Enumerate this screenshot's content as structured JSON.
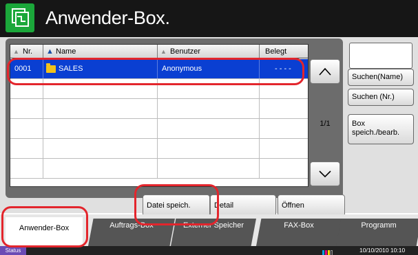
{
  "header": {
    "title": "Anwender-Box.",
    "icon": "document-box-icon"
  },
  "table": {
    "columns": [
      {
        "label": "Nr."
      },
      {
        "label": "Name"
      },
      {
        "label": "Benutzer"
      },
      {
        "label": "Belegt"
      }
    ],
    "rows": [
      {
        "nr": "0001",
        "name": "SALES",
        "user": "Anonymous",
        "used": "- - - -",
        "selected": true
      }
    ]
  },
  "pager": {
    "indicator": "1/1"
  },
  "side": {
    "search_name": "Suchen(Name)",
    "search_nr": "Suchen (Nr.)",
    "box_edit_line1": "Box",
    "box_edit_line2": "speich./bearb."
  },
  "actions": {
    "save_file": "Datei speich.",
    "detail": "Detail",
    "open": "Öffnen"
  },
  "tabs": [
    {
      "label": "Anwender-Box"
    },
    {
      "label": "Auftrags-Box"
    },
    {
      "label": "Externer Speicher"
    },
    {
      "label": "FAX-Box"
    },
    {
      "label": "Programm"
    }
  ],
  "status": {
    "button": "Status",
    "datetime": "10/10/2010  10:10"
  },
  "colors": {
    "header": "#161616",
    "accent_green": "#1ba73a",
    "selection": "#0a3fd2",
    "highlight": "#e3252c",
    "status_purple": "#6b4bb5"
  }
}
